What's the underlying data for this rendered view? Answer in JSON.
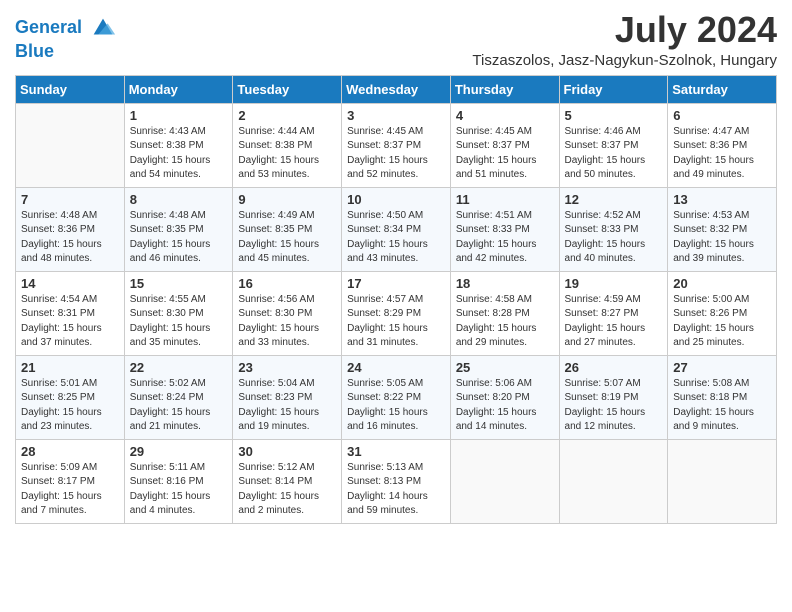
{
  "logo": {
    "line1": "General",
    "line2": "Blue"
  },
  "title": "July 2024",
  "location": "Tiszaszolos, Jasz-Nagykun-Szolnok, Hungary",
  "headers": [
    "Sunday",
    "Monday",
    "Tuesday",
    "Wednesday",
    "Thursday",
    "Friday",
    "Saturday"
  ],
  "weeks": [
    [
      {
        "day": "",
        "info": ""
      },
      {
        "day": "1",
        "info": "Sunrise: 4:43 AM\nSunset: 8:38 PM\nDaylight: 15 hours\nand 54 minutes."
      },
      {
        "day": "2",
        "info": "Sunrise: 4:44 AM\nSunset: 8:38 PM\nDaylight: 15 hours\nand 53 minutes."
      },
      {
        "day": "3",
        "info": "Sunrise: 4:45 AM\nSunset: 8:37 PM\nDaylight: 15 hours\nand 52 minutes."
      },
      {
        "day": "4",
        "info": "Sunrise: 4:45 AM\nSunset: 8:37 PM\nDaylight: 15 hours\nand 51 minutes."
      },
      {
        "day": "5",
        "info": "Sunrise: 4:46 AM\nSunset: 8:37 PM\nDaylight: 15 hours\nand 50 minutes."
      },
      {
        "day": "6",
        "info": "Sunrise: 4:47 AM\nSunset: 8:36 PM\nDaylight: 15 hours\nand 49 minutes."
      }
    ],
    [
      {
        "day": "7",
        "info": "Sunrise: 4:48 AM\nSunset: 8:36 PM\nDaylight: 15 hours\nand 48 minutes."
      },
      {
        "day": "8",
        "info": "Sunrise: 4:48 AM\nSunset: 8:35 PM\nDaylight: 15 hours\nand 46 minutes."
      },
      {
        "day": "9",
        "info": "Sunrise: 4:49 AM\nSunset: 8:35 PM\nDaylight: 15 hours\nand 45 minutes."
      },
      {
        "day": "10",
        "info": "Sunrise: 4:50 AM\nSunset: 8:34 PM\nDaylight: 15 hours\nand 43 minutes."
      },
      {
        "day": "11",
        "info": "Sunrise: 4:51 AM\nSunset: 8:33 PM\nDaylight: 15 hours\nand 42 minutes."
      },
      {
        "day": "12",
        "info": "Sunrise: 4:52 AM\nSunset: 8:33 PM\nDaylight: 15 hours\nand 40 minutes."
      },
      {
        "day": "13",
        "info": "Sunrise: 4:53 AM\nSunset: 8:32 PM\nDaylight: 15 hours\nand 39 minutes."
      }
    ],
    [
      {
        "day": "14",
        "info": "Sunrise: 4:54 AM\nSunset: 8:31 PM\nDaylight: 15 hours\nand 37 minutes."
      },
      {
        "day": "15",
        "info": "Sunrise: 4:55 AM\nSunset: 8:30 PM\nDaylight: 15 hours\nand 35 minutes."
      },
      {
        "day": "16",
        "info": "Sunrise: 4:56 AM\nSunset: 8:30 PM\nDaylight: 15 hours\nand 33 minutes."
      },
      {
        "day": "17",
        "info": "Sunrise: 4:57 AM\nSunset: 8:29 PM\nDaylight: 15 hours\nand 31 minutes."
      },
      {
        "day": "18",
        "info": "Sunrise: 4:58 AM\nSunset: 8:28 PM\nDaylight: 15 hours\nand 29 minutes."
      },
      {
        "day": "19",
        "info": "Sunrise: 4:59 AM\nSunset: 8:27 PM\nDaylight: 15 hours\nand 27 minutes."
      },
      {
        "day": "20",
        "info": "Sunrise: 5:00 AM\nSunset: 8:26 PM\nDaylight: 15 hours\nand 25 minutes."
      }
    ],
    [
      {
        "day": "21",
        "info": "Sunrise: 5:01 AM\nSunset: 8:25 PM\nDaylight: 15 hours\nand 23 minutes."
      },
      {
        "day": "22",
        "info": "Sunrise: 5:02 AM\nSunset: 8:24 PM\nDaylight: 15 hours\nand 21 minutes."
      },
      {
        "day": "23",
        "info": "Sunrise: 5:04 AM\nSunset: 8:23 PM\nDaylight: 15 hours\nand 19 minutes."
      },
      {
        "day": "24",
        "info": "Sunrise: 5:05 AM\nSunset: 8:22 PM\nDaylight: 15 hours\nand 16 minutes."
      },
      {
        "day": "25",
        "info": "Sunrise: 5:06 AM\nSunset: 8:20 PM\nDaylight: 15 hours\nand 14 minutes."
      },
      {
        "day": "26",
        "info": "Sunrise: 5:07 AM\nSunset: 8:19 PM\nDaylight: 15 hours\nand 12 minutes."
      },
      {
        "day": "27",
        "info": "Sunrise: 5:08 AM\nSunset: 8:18 PM\nDaylight: 15 hours\nand 9 minutes."
      }
    ],
    [
      {
        "day": "28",
        "info": "Sunrise: 5:09 AM\nSunset: 8:17 PM\nDaylight: 15 hours\nand 7 minutes."
      },
      {
        "day": "29",
        "info": "Sunrise: 5:11 AM\nSunset: 8:16 PM\nDaylight: 15 hours\nand 4 minutes."
      },
      {
        "day": "30",
        "info": "Sunrise: 5:12 AM\nSunset: 8:14 PM\nDaylight: 15 hours\nand 2 minutes."
      },
      {
        "day": "31",
        "info": "Sunrise: 5:13 AM\nSunset: 8:13 PM\nDaylight: 14 hours\nand 59 minutes."
      },
      {
        "day": "",
        "info": ""
      },
      {
        "day": "",
        "info": ""
      },
      {
        "day": "",
        "info": ""
      }
    ]
  ]
}
